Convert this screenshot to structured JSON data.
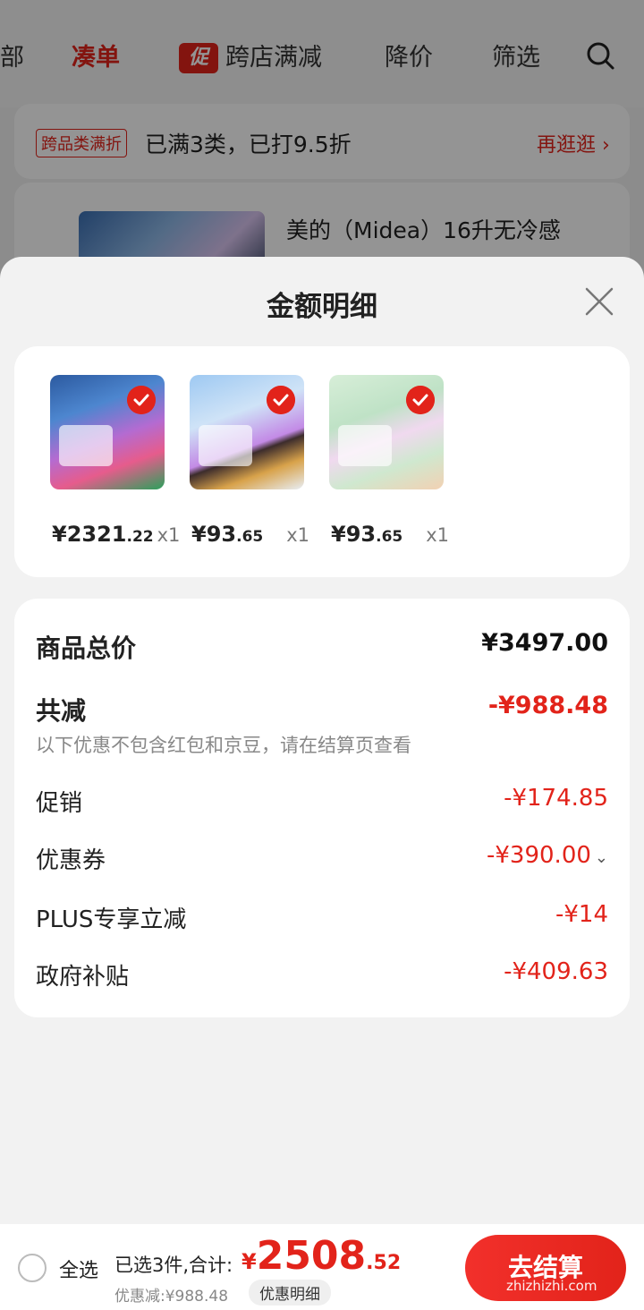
{
  "nav": {
    "items": [
      "部",
      "凑单",
      "跨店满减",
      "降价",
      "筛选"
    ],
    "promo_tag": "促"
  },
  "banner": {
    "tag": "跨品类满折",
    "text": "已满3类，已打9.5折",
    "link": "再逛逛 ›"
  },
  "bg_product": {
    "title": "美的（Midea）16升无冷感"
  },
  "sheet": {
    "title": "金额明细",
    "goods": [
      {
        "price_int": "¥2321",
        "price_dec": ".22",
        "qty": "x1"
      },
      {
        "price_int": "¥93",
        "price_dec": ".65",
        "qty": "x1"
      },
      {
        "price_int": "¥93",
        "price_dec": ".65",
        "qty": "x1"
      }
    ],
    "details": {
      "total_label": "商品总价",
      "total_value": "¥3497.00",
      "reduce_label": "共减",
      "reduce_value": "-¥988.48",
      "note": "以下优惠不包含红包和京豆，请在结算页查看",
      "rows": [
        {
          "label": "促销",
          "value": "-¥174.85"
        },
        {
          "label": "优惠券",
          "value": "-¥390.00"
        },
        {
          "label": "PLUS专享立减",
          "value": "-¥14"
        },
        {
          "label": "政府补贴",
          "value": "-¥409.63"
        }
      ]
    }
  },
  "bottom": {
    "select_all": "全选",
    "summary_label": "已选3件,合计:",
    "sum_symbol": "¥",
    "sum_int": "2508",
    "sum_dec": ".52",
    "discount_text": "优惠减:¥988.48",
    "discount_btn": "优惠明细",
    "checkout": "去结算",
    "watermark": "zhizhizhi.com"
  },
  "colors": {
    "accent": "#e2231a",
    "sheet_bg": "#f2f2f2"
  }
}
